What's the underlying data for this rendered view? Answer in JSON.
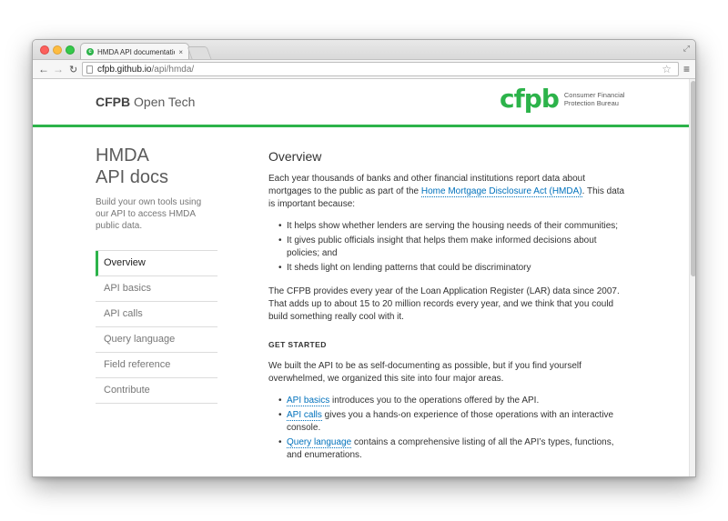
{
  "browser": {
    "tab_title": "HMDA API documentation",
    "tab_close": "×",
    "favicon_letter": "c",
    "url_host": "cfpb.github.io",
    "url_path": "/api/hmda/"
  },
  "header": {
    "brand_bold": "CFPB",
    "brand_rest": " Open Tech",
    "logo_mark": "cfpb",
    "logo_line1": "Consumer Financial",
    "logo_line2": "Protection Bureau",
    "accent_color": "#2cb34a"
  },
  "sidebar": {
    "title_line1": "HMDA",
    "title_line2": "API docs",
    "description": "Build your own tools using our API to access HMDA public data.",
    "items": [
      {
        "label": "Overview",
        "active": true
      },
      {
        "label": "API basics"
      },
      {
        "label": "API calls"
      },
      {
        "label": "Query language"
      },
      {
        "label": "Field reference"
      },
      {
        "label": "Contribute"
      }
    ]
  },
  "main": {
    "heading": "Overview",
    "intro_before": "Each year thousands of banks and other financial institutions report data about mortgages to the public as part of the ",
    "intro_link": "Home Mortgage Disclosure Act (HMDA)",
    "intro_after": ". This data is important because:",
    "bullets": [
      "It helps show whether lenders are serving the housing needs of their communities;",
      "It gives public officials insight that helps them make informed decisions about policies; and",
      "It sheds light on lending patterns that could be discriminatory"
    ],
    "paragraph2": "The CFPB provides every year of the Loan Application Register (LAR) data since 2007. That adds up to about 15 to 20 million records every year, and we think that you could build something really cool with it.",
    "subheading": "GET STARTED",
    "paragraph3": "We built the API to be as self-documenting as possible, but if you find yourself overwhelmed, we organized this site into four major areas.",
    "links": [
      {
        "link": "API basics",
        "text": " introduces you to the operations offered by the API."
      },
      {
        "link": "API calls",
        "text": " gives you a hands-on experience of those operations with an interactive console."
      },
      {
        "link": "Query language",
        "text": " contains a comprehensive listing of all the API’s types, functions, and enumerations."
      }
    ]
  }
}
